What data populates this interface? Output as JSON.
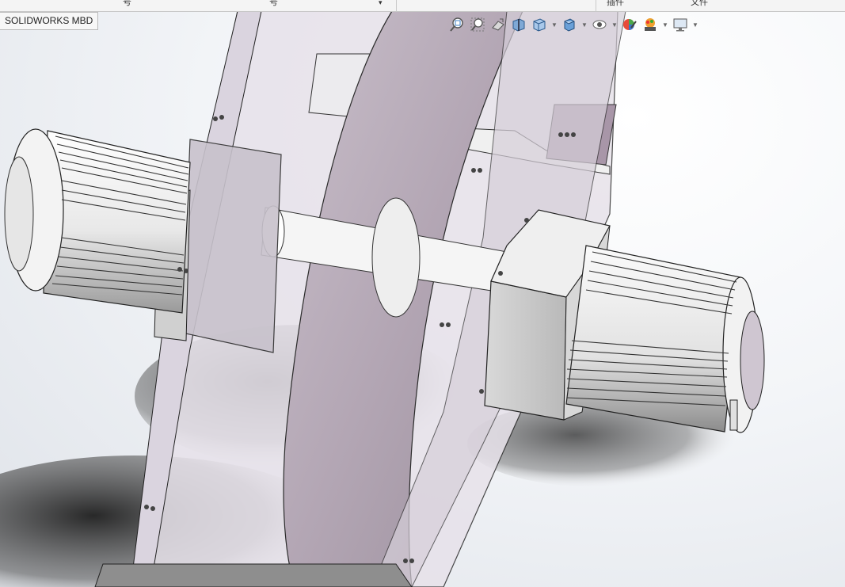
{
  "window": {
    "top_fragments": [
      "号",
      "号",
      "▾",
      "插件",
      "文件"
    ]
  },
  "viewport_tab": {
    "label": "SOLIDWORKS MBD"
  },
  "heads_up_toolbar": {
    "items": [
      {
        "name": "zoom-to-fit-icon"
      },
      {
        "name": "zoom-to-area-icon"
      },
      {
        "name": "previous-view-icon"
      },
      {
        "name": "section-view-icon"
      },
      {
        "name": "view-orientation-icon",
        "has_dropdown": true
      },
      {
        "name": "display-style-icon",
        "has_dropdown": true
      },
      {
        "name": "hide-show-items-icon",
        "has_dropdown": true
      },
      {
        "name": "edit-appearance-icon"
      },
      {
        "name": "apply-scene-icon",
        "has_dropdown": true
      },
      {
        "name": "view-settings-icon",
        "has_dropdown": true
      }
    ]
  },
  "model": {
    "description_colors": {
      "housing": "#d9d2dc",
      "disc": "#b7abb8",
      "motor": "#e9e9e9",
      "shadow": "#2b2b2b",
      "edge": "#1f1f1f"
    }
  }
}
